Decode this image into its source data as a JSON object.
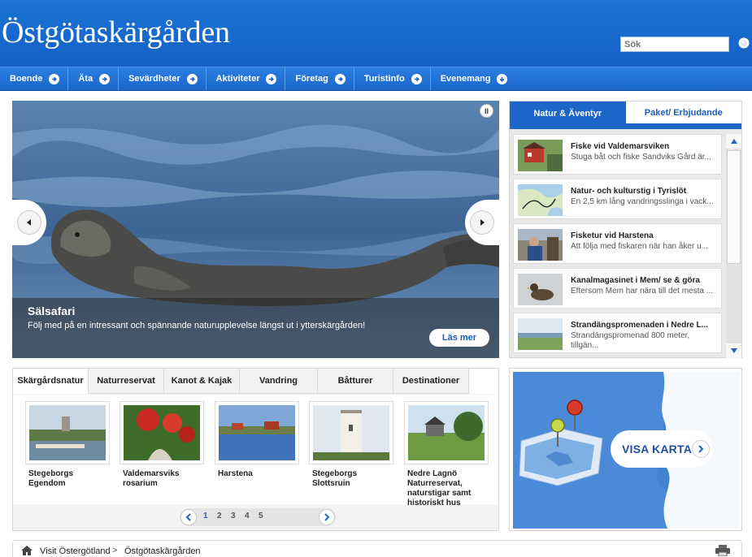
{
  "header": {
    "title": "Östgötaskärgården",
    "search_placeholder": "Sök"
  },
  "nav": {
    "items": [
      {
        "label": "Boende",
        "icon": "arrow-right-icon"
      },
      {
        "label": "Äta",
        "icon": "arrow-right-icon"
      },
      {
        "label": "Sevärdheter",
        "icon": "arrow-right-icon"
      },
      {
        "label": "Aktiviteter",
        "icon": "arrow-right-icon"
      },
      {
        "label": "Företag",
        "icon": "arrow-right-icon"
      },
      {
        "label": "Turistinfo",
        "icon": "arrow-right-icon"
      },
      {
        "label": "Evenemang",
        "icon": "arrow-down-icon"
      }
    ]
  },
  "hero": {
    "title": "Sälsafari",
    "text": "Följ med på en intressant och spännande naturupplevelse längst ut i ytterskärgården!",
    "button": "Läs mer",
    "pause": "II"
  },
  "side": {
    "tabs": [
      "Natur & Äventyr",
      "Paket/ Erbjudande"
    ],
    "items": [
      {
        "title": "Fiske vid Valdemarsviken",
        "text": "Stuga båt och fiske Sandviks Gård är..."
      },
      {
        "title": "Natur- och kulturstig i Tyrislöt",
        "text": "En 2,5 km lång vandringsslinga i vack..."
      },
      {
        "title": "Fisketur vid Harstena",
        "text": "Att följa med fiskaren när han åker u..."
      },
      {
        "title": "Kanalmagasinet i Mem/ se & göra",
        "text": "Eftersom Mem har nära till det mesta ..."
      },
      {
        "title": "Strandängspromenaden i Nedre L...",
        "text": "Strandängspromenad 800 meter, tillgän..."
      }
    ]
  },
  "gallery": {
    "tabs": [
      "Skärgårdsnatur",
      "Naturreservat",
      "Kanot & Kajak",
      "Vandring",
      "Båtturer",
      "Destinationer"
    ],
    "items": [
      {
        "label": "Stegeborgs Egendom"
      },
      {
        "label": "Valdemarsviks rosarium"
      },
      {
        "label": "Harstena"
      },
      {
        "label": "Stegeborgs Slottsruin"
      },
      {
        "label": "Nedre Lagnö Naturreservat, naturstigar samt historiskt hus"
      }
    ],
    "pages": [
      "1",
      "2",
      "3",
      "4",
      "5"
    ],
    "current_page": "1"
  },
  "map": {
    "label": "VISA KARTA"
  },
  "breadcrumb": {
    "items": [
      "Visit Östergötland",
      "Östgötaskärgården"
    ],
    "separator": ">"
  },
  "colors": {
    "brand_blue": "#1c66c8",
    "header_blue": "#1b74d6"
  }
}
